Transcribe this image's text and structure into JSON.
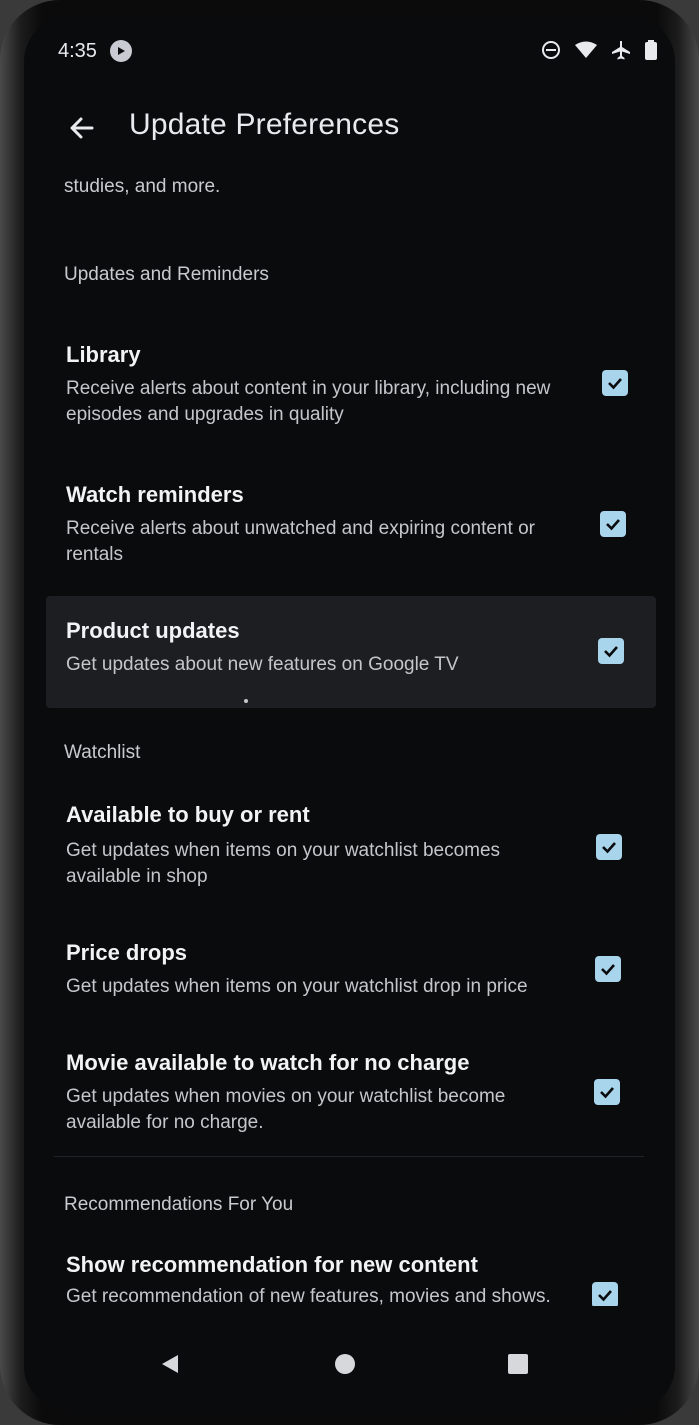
{
  "status_bar": {
    "time": "4:35",
    "icons": [
      "app-notification-icon",
      "dnd-icon",
      "wifi-icon",
      "airplane-icon",
      "battery-icon"
    ]
  },
  "app_bar": {
    "title": "Update Preferences"
  },
  "intro_text": "studies, and more.",
  "sections": {
    "updates": {
      "header": "Updates and Reminders",
      "items": [
        {
          "title": "Library",
          "description": "Receive alerts about content in your library, including new episodes and upgrades in quality",
          "checked": true
        },
        {
          "title": "Watch reminders",
          "description": "Receive alerts about unwatched and expiring content or rentals",
          "checked": true
        },
        {
          "title": "Product updates",
          "description": "Get updates about new features on Google TV",
          "checked": true
        }
      ]
    },
    "watchlist": {
      "header": "Watchlist",
      "items": [
        {
          "title": "Available to buy or rent",
          "description": "Get updates when items on your watchlist becomes available in shop",
          "checked": true
        },
        {
          "title": "Price drops",
          "description": "Get updates when items on your watchlist drop in price",
          "checked": true
        },
        {
          "title": "Movie available to watch for no charge",
          "description": "Get updates when movies on your watchlist become available for no charge.",
          "checked": true
        }
      ]
    },
    "recommendations": {
      "header": "Recommendations For You",
      "items": [
        {
          "title": "Show recommendation for new content",
          "description": "Get recommendation of new features, movies and shows.",
          "checked": true
        }
      ]
    }
  },
  "nav_bar": {
    "buttons": [
      "back-icon",
      "home-icon",
      "recents-icon"
    ]
  },
  "colors": {
    "background": "#0a0b0d",
    "checkbox": "#a8d4ec",
    "highlight_row": "#1c1e22",
    "text_primary": "#f1f3f4",
    "text_secondary": "#c4c7ca"
  }
}
